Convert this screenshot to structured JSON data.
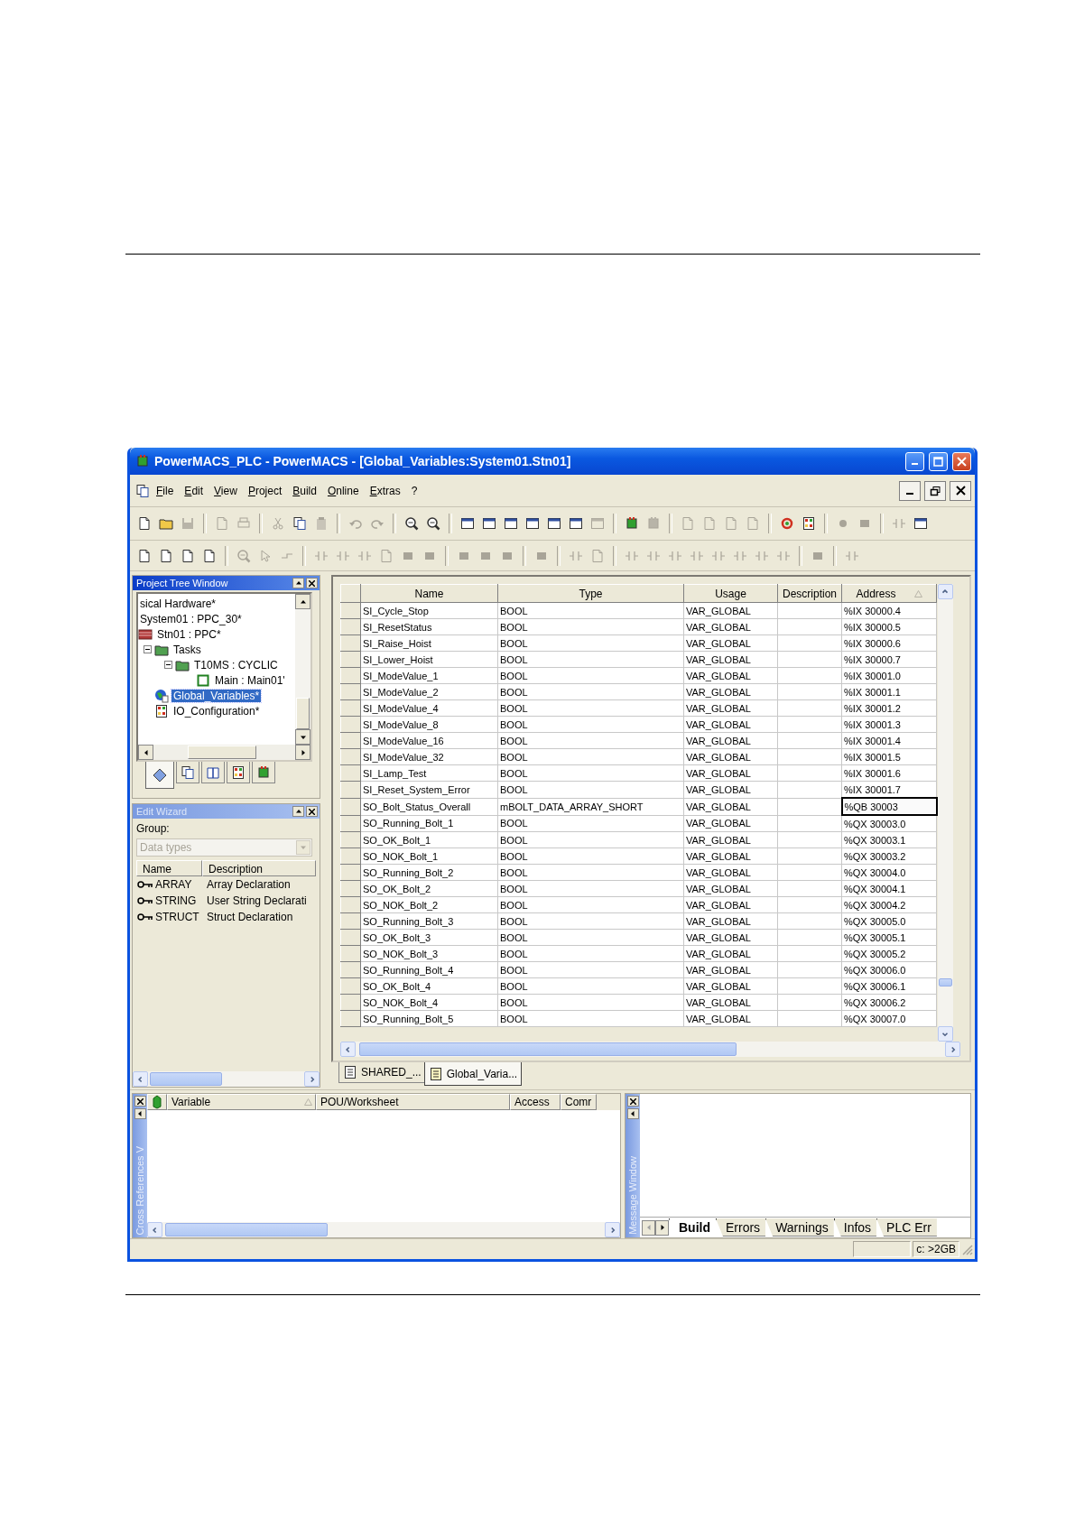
{
  "window": {
    "title": "PowerMACS_PLC - PowerMACS - [Global_Variables:System01.Stn01]"
  },
  "menu": [
    "File",
    "Edit",
    "View",
    "Project",
    "Build",
    "Online",
    "Extras",
    "?"
  ],
  "toolbars": [
    {
      "groups": [
        {
          "buttons": [
            {
              "disabled": false
            },
            {
              "disabled": false
            },
            {
              "disabled": true
            }
          ]
        },
        {
          "buttons": [
            {
              "disabled": true
            },
            {
              "disabled": true
            }
          ]
        },
        {
          "buttons": [
            {
              "disabled": true
            },
            {
              "disabled": false
            },
            {
              "disabled": true
            }
          ]
        },
        {
          "buttons": [
            {
              "disabled": true
            },
            {
              "disabled": true
            }
          ]
        },
        {
          "buttons": [
            {
              "disabled": false
            },
            {
              "disabled": false
            }
          ]
        },
        {
          "buttons": [
            {
              "disabled": false
            },
            {
              "disabled": false
            },
            {
              "disabled": false
            },
            {
              "disabled": false
            },
            {
              "disabled": false
            },
            {
              "disabled": false
            },
            {
              "disabled": true
            }
          ]
        },
        {
          "buttons": [
            {
              "disabled": false
            },
            {
              "disabled": true
            }
          ]
        },
        {
          "buttons": [
            {
              "disabled": true
            },
            {
              "disabled": true
            },
            {
              "disabled": true
            },
            {
              "disabled": true
            }
          ]
        },
        {
          "buttons": [
            {
              "disabled": false
            },
            {
              "disabled": false
            }
          ]
        },
        {
          "buttons": [
            {
              "disabled": true
            },
            {
              "disabled": true
            }
          ]
        },
        {
          "buttons": [
            {
              "disabled": true
            },
            {
              "disabled": false
            }
          ]
        }
      ]
    },
    {
      "groups": [
        {
          "buttons": [
            {
              "disabled": false
            },
            {
              "disabled": false
            },
            {
              "disabled": false
            },
            {
              "disabled": false
            }
          ]
        },
        {
          "buttons": [
            {
              "disabled": true
            },
            {
              "disabled": true
            },
            {
              "disabled": true
            }
          ]
        },
        {
          "buttons": [
            {
              "disabled": true
            },
            {
              "disabled": true
            },
            {
              "disabled": true
            },
            {
              "disabled": true
            },
            {
              "disabled": true
            },
            {
              "disabled": true
            }
          ]
        },
        {
          "buttons": [
            {
              "disabled": true
            },
            {
              "disabled": true
            },
            {
              "disabled": true
            }
          ]
        },
        {
          "buttons": [
            {
              "disabled": true
            }
          ]
        },
        {
          "buttons": [
            {
              "disabled": true
            },
            {
              "disabled": true
            }
          ]
        },
        {
          "buttons": [
            {
              "disabled": true
            },
            {
              "disabled": true
            },
            {
              "disabled": true
            },
            {
              "disabled": true
            },
            {
              "disabled": true
            },
            {
              "disabled": true
            },
            {
              "disabled": true
            },
            {
              "disabled": true
            }
          ]
        },
        {
          "buttons": [
            {
              "disabled": true
            }
          ]
        },
        {
          "buttons": [
            {
              "disabled": true
            }
          ]
        }
      ]
    }
  ],
  "project_tree": {
    "title": "Project Tree Window",
    "items": [
      {
        "label": "sical Hardware*",
        "selected": false,
        "children": [
          {
            "label": "System01 : PPC_30*",
            "selected": false,
            "children": [
              {
                "label": "Stn01 : PPC*",
                "kind": "station",
                "selected": false,
                "children": [
                  {
                    "label": "Tasks",
                    "kind": "folder",
                    "selected": false,
                    "expanded": true,
                    "children": [
                      {
                        "label": "T10MS : CYCLIC",
                        "kind": "folder",
                        "selected": false,
                        "expanded": true,
                        "children": [
                          {
                            "label": "Main : Main01'",
                            "kind": "program",
                            "selected": false
                          }
                        ]
                      }
                    ]
                  },
                  {
                    "label": "Global_Variables*",
                    "kind": "variables",
                    "selected": true
                  },
                  {
                    "label": "IO_Configuration*",
                    "kind": "io",
                    "selected": false
                  }
                ]
              }
            ]
          }
        ]
      }
    ],
    "tabs": [
      {
        "selected": true
      },
      {
        "selected": false
      },
      {
        "selected": false
      },
      {
        "selected": false
      },
      {
        "selected": false
      }
    ]
  },
  "edit_wizard": {
    "title": "Edit Wizard",
    "group_label": "Group:",
    "group": {
      "value": "Data types",
      "disabled": true
    },
    "columns": [
      "Name",
      "Description"
    ],
    "rows": [
      {
        "name": "ARRAY",
        "description": "Array Declaration"
      },
      {
        "name": "STRING",
        "description": "User String Declarati"
      },
      {
        "name": "STRUCT",
        "description": "Struct Declaration"
      }
    ]
  },
  "variables_table": {
    "columns": [
      {
        "label": "Name",
        "sorted": false
      },
      {
        "label": "Type",
        "sorted": false
      },
      {
        "label": "Usage",
        "sorted": false
      },
      {
        "label": "Description",
        "sorted": false
      },
      {
        "label": "Address",
        "sorted": true
      }
    ],
    "rows": [
      {
        "name": "SI_Cycle_Stop",
        "type": "BOOL",
        "usage": "VAR_GLOBAL",
        "address": "%IX 30000.4",
        "focused": false
      },
      {
        "name": "SI_ResetStatus",
        "type": "BOOL",
        "usage": "VAR_GLOBAL",
        "address": "%IX 30000.5",
        "focused": false
      },
      {
        "name": "SI_Raise_Hoist",
        "type": "BOOL",
        "usage": "VAR_GLOBAL",
        "address": "%IX 30000.6",
        "focused": false
      },
      {
        "name": "SI_Lower_Hoist",
        "type": "BOOL",
        "usage": "VAR_GLOBAL",
        "address": "%IX 30000.7",
        "focused": false
      },
      {
        "name": "SI_ModeValue_1",
        "type": "BOOL",
        "usage": "VAR_GLOBAL",
        "address": "%IX 30001.0",
        "focused": false
      },
      {
        "name": "SI_ModeValue_2",
        "type": "BOOL",
        "usage": "VAR_GLOBAL",
        "address": "%IX 30001.1",
        "focused": false
      },
      {
        "name": "SI_ModeValue_4",
        "type": "BOOL",
        "usage": "VAR_GLOBAL",
        "address": "%IX 30001.2",
        "focused": false
      },
      {
        "name": "SI_ModeValue_8",
        "type": "BOOL",
        "usage": "VAR_GLOBAL",
        "address": "%IX 30001.3",
        "focused": false
      },
      {
        "name": "SI_ModeValue_16",
        "type": "BOOL",
        "usage": "VAR_GLOBAL",
        "address": "%IX 30001.4",
        "focused": false
      },
      {
        "name": "SI_ModeValue_32",
        "type": "BOOL",
        "usage": "VAR_GLOBAL",
        "address": "%IX 30001.5",
        "focused": false
      },
      {
        "name": "SI_Lamp_Test",
        "type": "BOOL",
        "usage": "VAR_GLOBAL",
        "address": "%IX 30001.6",
        "focused": false
      },
      {
        "name": "SI_Reset_System_Error",
        "type": "BOOL",
        "usage": "VAR_GLOBAL",
        "address": "%IX 30001.7",
        "focused": false
      },
      {
        "name": "SO_Bolt_Status_Overall",
        "type": "mBOLT_DATA_ARRAY_SHORT",
        "usage": "VAR_GLOBAL",
        "address": "%QB 30003",
        "focused": true
      },
      {
        "name": "SO_Running_Bolt_1",
        "type": "BOOL",
        "usage": "VAR_GLOBAL",
        "address": "%QX 30003.0",
        "focused": false
      },
      {
        "name": "SO_OK_Bolt_1",
        "type": "BOOL",
        "usage": "VAR_GLOBAL",
        "address": "%QX 30003.1",
        "focused": false
      },
      {
        "name": "SO_NOK_Bolt_1",
        "type": "BOOL",
        "usage": "VAR_GLOBAL",
        "address": "%QX 30003.2",
        "focused": false
      },
      {
        "name": "SO_Running_Bolt_2",
        "type": "BOOL",
        "usage": "VAR_GLOBAL",
        "address": "%QX 30004.0",
        "focused": false
      },
      {
        "name": "SO_OK_Bolt_2",
        "type": "BOOL",
        "usage": "VAR_GLOBAL",
        "address": "%QX 30004.1",
        "focused": false
      },
      {
        "name": "SO_NOK_Bolt_2",
        "type": "BOOL",
        "usage": "VAR_GLOBAL",
        "address": "%QX 30004.2",
        "focused": false
      },
      {
        "name": "SO_Running_Bolt_3",
        "type": "BOOL",
        "usage": "VAR_GLOBAL",
        "address": "%QX 30005.0",
        "focused": false
      },
      {
        "name": "SO_OK_Bolt_3",
        "type": "BOOL",
        "usage": "VAR_GLOBAL",
        "address": "%QX 30005.1",
        "focused": false
      },
      {
        "name": "SO_NOK_Bolt_3",
        "type": "BOOL",
        "usage": "VAR_GLOBAL",
        "address": "%QX 30005.2",
        "focused": false
      },
      {
        "name": "SO_Running_Bolt_4",
        "type": "BOOL",
        "usage": "VAR_GLOBAL",
        "address": "%QX 30006.0",
        "focused": false
      },
      {
        "name": "SO_OK_Bolt_4",
        "type": "BOOL",
        "usage": "VAR_GLOBAL",
        "address": "%QX 30006.1",
        "focused": false
      },
      {
        "name": "SO_NOK_Bolt_4",
        "type": "BOOL",
        "usage": "VAR_GLOBAL",
        "address": "%QX 30006.2",
        "focused": false
      },
      {
        "name": "SO_Running_Bolt_5",
        "type": "BOOL",
        "usage": "VAR_GLOBAL",
        "address": "%QX 30007.0",
        "focused": false
      }
    ]
  },
  "document_tabs": [
    {
      "label": "SHARED_...",
      "selected": false
    },
    {
      "label": "Global_Varia...",
      "selected": true
    }
  ],
  "cross_references": {
    "title": "Cross References V",
    "columns": [
      {
        "label": "Variable",
        "sorted": true
      },
      {
        "label": "POU/Worksheet",
        "sorted": false
      },
      {
        "label": "Access",
        "sorted": false
      },
      {
        "label": "Comr",
        "sorted": false
      }
    ]
  },
  "message_window": {
    "title": "Message Window",
    "tabs": [
      {
        "label": "Build",
        "selected": true
      },
      {
        "label": "Errors",
        "selected": false
      },
      {
        "label": "Warnings",
        "selected": false
      },
      {
        "label": "Infos",
        "selected": false
      },
      {
        "label": "PLC Err",
        "selected": false
      }
    ]
  },
  "status_bar": {
    "cells": [
      "c: >2GB"
    ]
  }
}
